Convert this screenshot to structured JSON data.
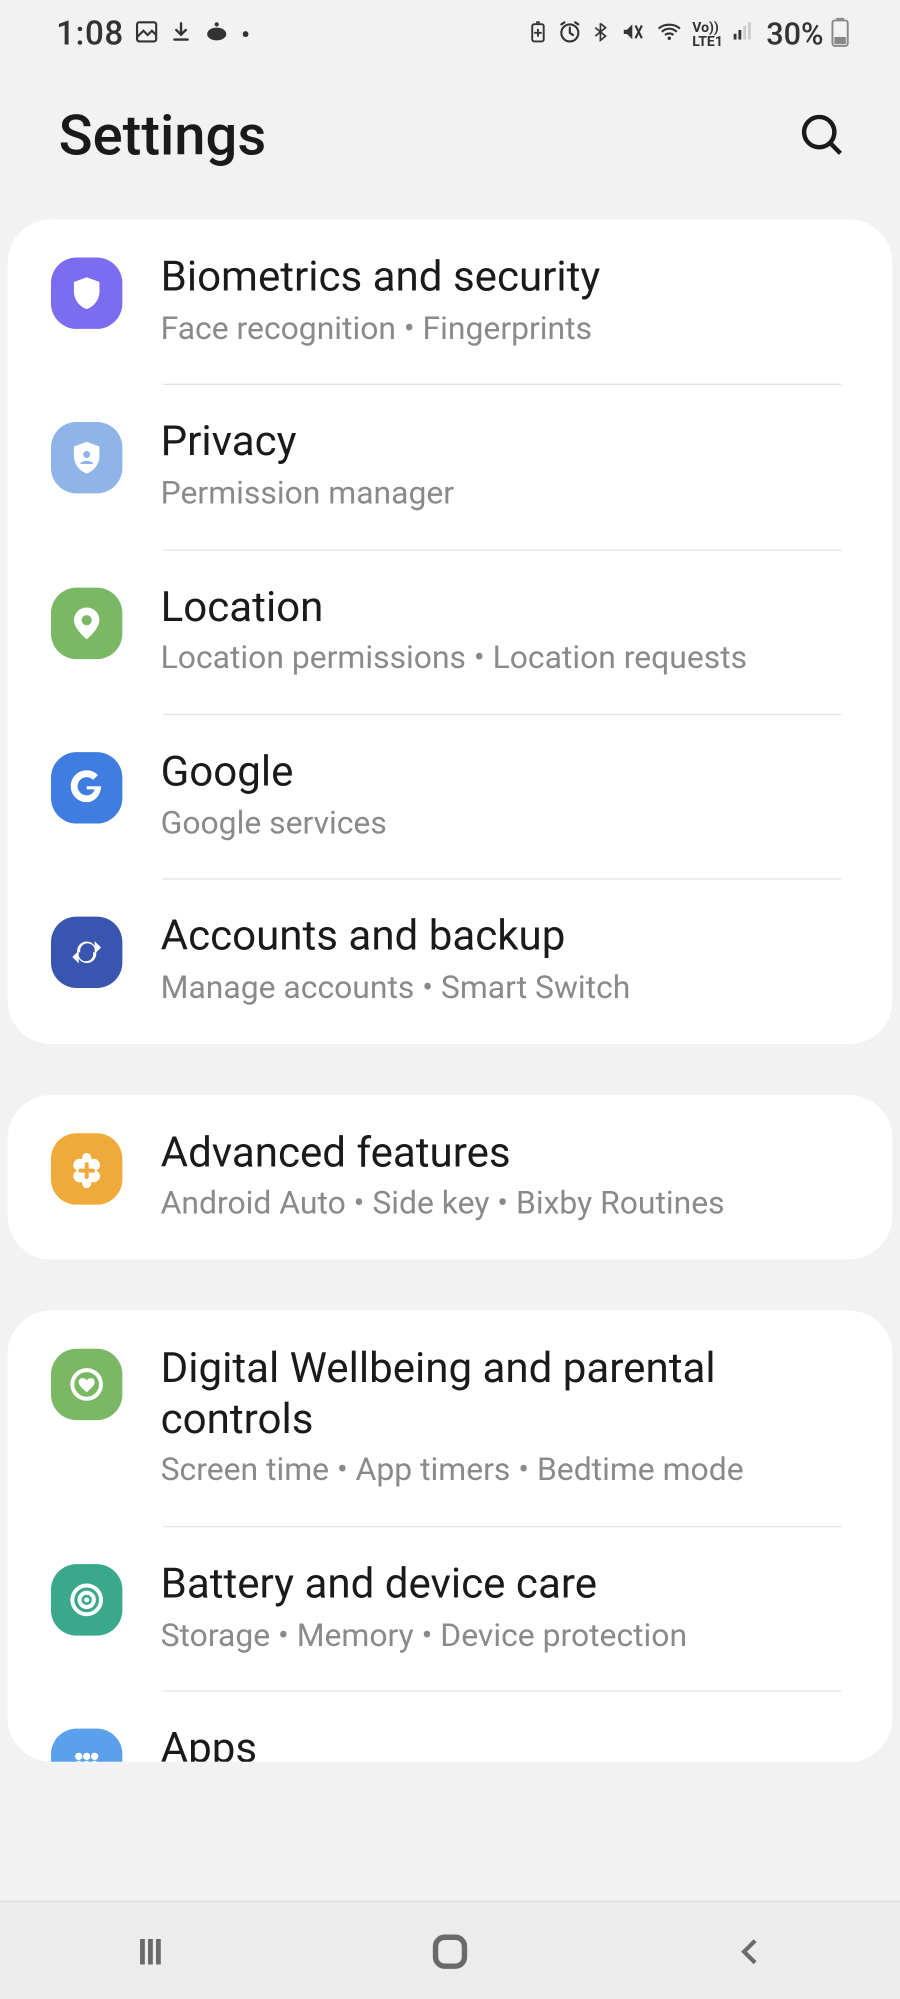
{
  "statusbar": {
    "time": "1:08",
    "battery_pct": "30%"
  },
  "header": {
    "title": "Settings"
  },
  "groups": [
    {
      "items": [
        {
          "id": "biometrics",
          "title": "Biometrics and security",
          "sub": "Face recognition  •  Fingerprints",
          "icon": "shield",
          "color": "ic-purple"
        },
        {
          "id": "privacy",
          "title": "Privacy",
          "sub": "Permission manager",
          "icon": "shield-person",
          "color": "ic-blue-lt"
        },
        {
          "id": "location",
          "title": "Location",
          "sub": "Location permissions  •  Location requests",
          "icon": "pin",
          "color": "ic-green"
        },
        {
          "id": "google",
          "title": "Google",
          "sub": "Google services",
          "icon": "google",
          "color": "ic-blue"
        },
        {
          "id": "accounts",
          "title": "Accounts and backup",
          "sub": "Manage accounts  •  Smart Switch",
          "icon": "sync",
          "color": "ic-indigo"
        }
      ]
    },
    {
      "items": [
        {
          "id": "advanced",
          "title": "Advanced features",
          "sub": "Android Auto  •  Side key  •  Bixby Routines",
          "icon": "plus-flower",
          "color": "ic-orange"
        }
      ]
    },
    {
      "items": [
        {
          "id": "wellbeing",
          "title": "Digital Wellbeing and parental controls",
          "sub": "Screen time  •  App timers  •  Bedtime mode",
          "icon": "heart-ring",
          "color": "ic-green2"
        },
        {
          "id": "battery",
          "title": "Battery and device care",
          "sub": "Storage  •  Memory  •  Device protection",
          "icon": "target",
          "color": "ic-teal"
        },
        {
          "id": "apps",
          "title": "Apps",
          "sub": "",
          "icon": "grid",
          "color": "ic-skyblue",
          "cutoff": true
        }
      ]
    }
  ]
}
